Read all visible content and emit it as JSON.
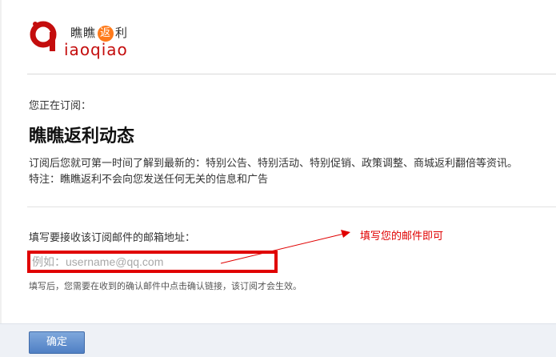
{
  "logo": {
    "cn_part1": "瞧瞧",
    "cn_circle": "返",
    "cn_part2": "利",
    "en": "iaoqiao",
    "brand_color": "#c40d0d",
    "accent_color": "#ff7a1a"
  },
  "subscription": {
    "label": "您正在订阅：",
    "title": "瞧瞧返利动态",
    "description": "订阅后您就可第一时间了解到最新的：特别公告、特别活动、特别促销、政策调整、商城返利翻倍等资讯。",
    "note": "特注：瞧瞧返利不会向您发送任何无关的信息和广告"
  },
  "email": {
    "label": "填写要接收该订阅邮件的邮箱地址：",
    "value": "",
    "placeholder": "例如：username@qq.com",
    "hint": "填写后，您需要在收到的确认邮件中点击确认链接，该订阅才会生效。"
  },
  "annotation": {
    "text": "填写您的邮件即可",
    "color": "#e00000"
  },
  "footer": {
    "confirm_label": "确定"
  }
}
